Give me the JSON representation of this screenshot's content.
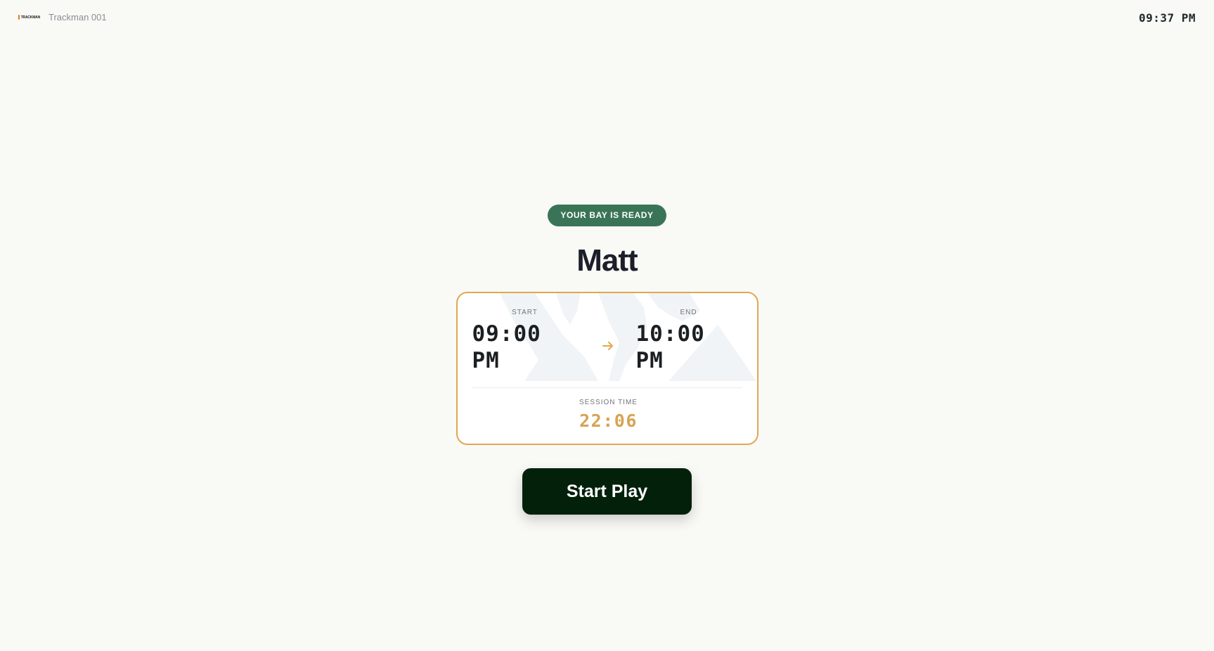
{
  "header": {
    "logo_text": "TRACKMAN",
    "bay_name": "Trackman 001",
    "clock": "09:37 PM"
  },
  "status_badge": "YOUR BAY IS READY",
  "guest_name": "Matt",
  "session_card": {
    "start_label": "START",
    "start_time": "09:00 PM",
    "end_label": "END",
    "end_time": "10:00 PM",
    "session_label": "SESSION TIME",
    "session_time": "22:06"
  },
  "actions": {
    "start_play_label": "Start Play"
  },
  "colors": {
    "badge_green": "#3a7456",
    "card_border": "#e0a850",
    "session_accent": "#d7a352",
    "button_dark": "#03200b",
    "arrow": "#e0a850"
  },
  "icons": {
    "arrow": "arrow-right-icon"
  }
}
